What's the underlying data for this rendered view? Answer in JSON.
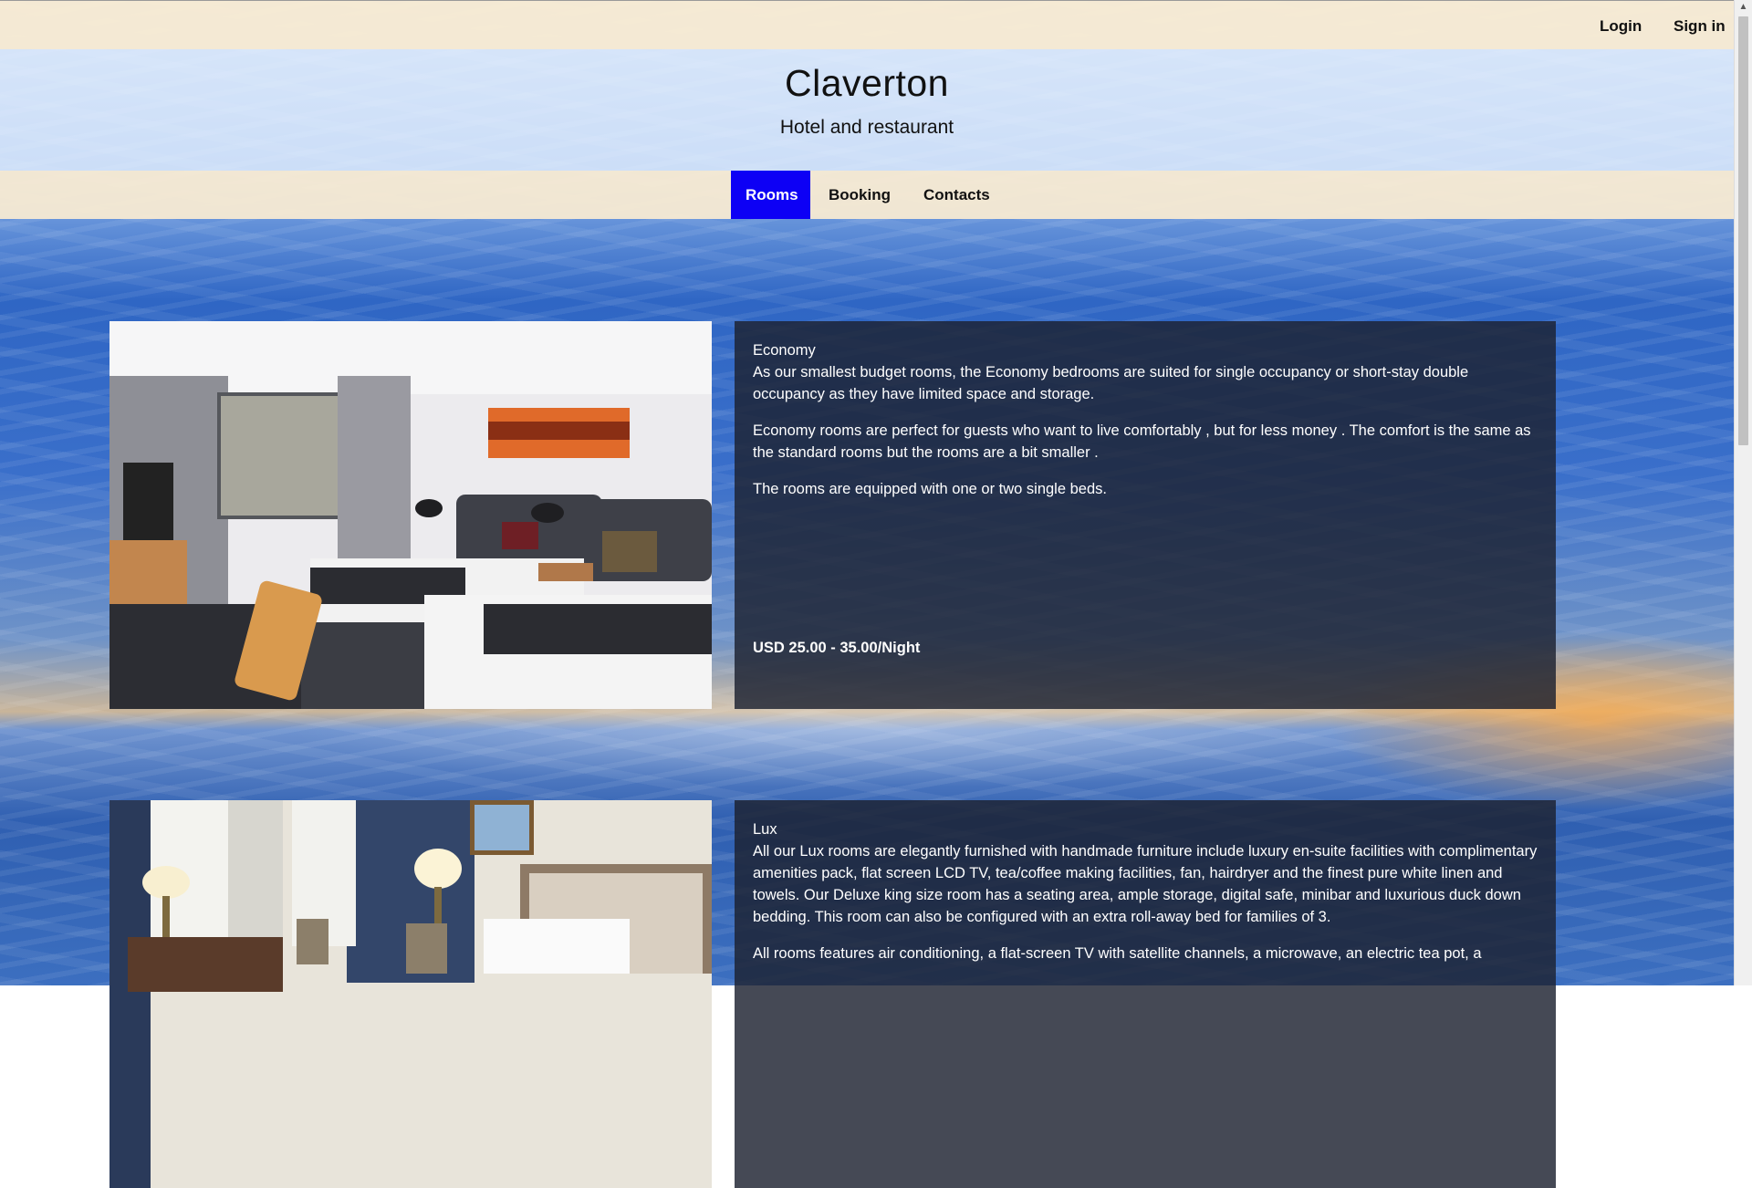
{
  "header": {
    "login_label": "Login",
    "signin_label": "Sign in",
    "title": "Claverton",
    "subtitle": "Hotel and restaurant"
  },
  "nav": {
    "items": [
      {
        "label": "Rooms",
        "active": true
      },
      {
        "label": "Booking",
        "active": false
      },
      {
        "label": "Contacts",
        "active": false
      }
    ]
  },
  "rooms": [
    {
      "name": "Economy",
      "paragraphs": [
        "As our smallest budget rooms, the Economy bedrooms are suited for single occupancy or short-stay double occupancy as they have limited space and storage.",
        "Economy rooms are perfect for guests who want to live comfortably , but for less money . The comfort is the same as the standard rooms but the rooms are a bit smaller .",
        "The rooms are equipped with one or two single beds."
      ],
      "price": "USD 25.00 - 35.00/Night"
    },
    {
      "name": "Lux",
      "paragraphs": [
        "All our Lux rooms are elegantly furnished with handmade furniture include luxury en-suite facilities with complimentary amenities pack, flat screen LCD TV, tea/coffee making facilities, fan, hairdryer and the finest pure white linen and towels. Our Deluxe king size room has a seating area, ample storage, digital safe, minibar and luxurious duck down bedding. This room can also be configured with an extra roll-away bed for families of 3.",
        "All rooms features air conditioning, a flat-screen TV with satellite channels, a microwave, an electric tea pot, a"
      ]
    }
  ],
  "colors": {
    "active_nav": "#0d00f5",
    "bar_background": "#faecd2",
    "card_background": "#1c2130"
  }
}
